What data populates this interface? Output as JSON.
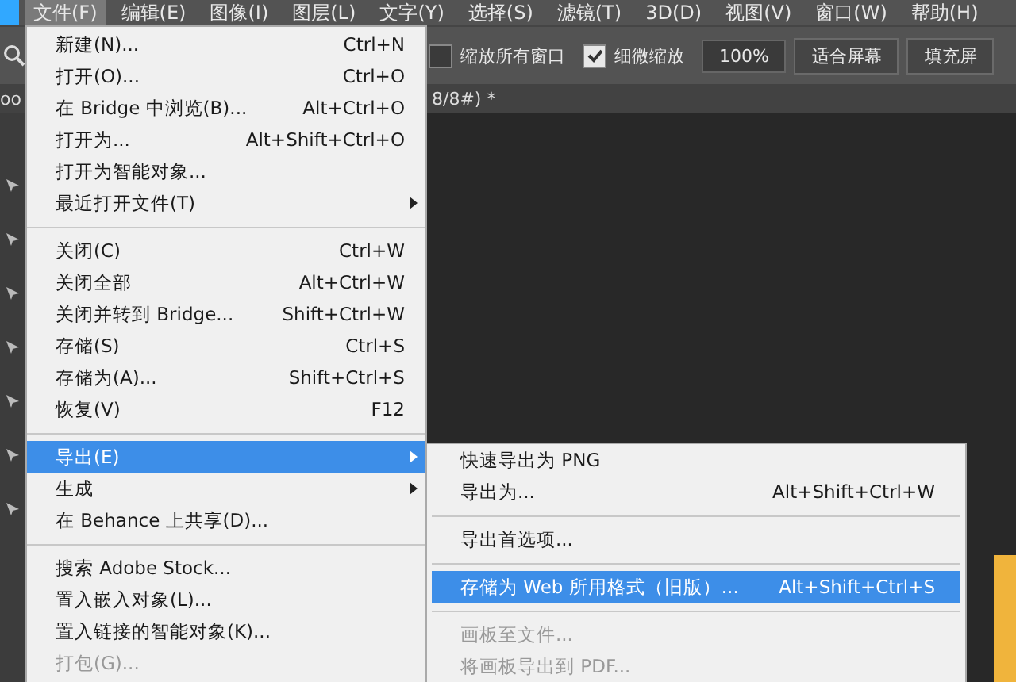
{
  "menubar": [
    {
      "label": "文件(F)",
      "selected": true
    },
    {
      "label": "编辑(E)",
      "selected": false
    },
    {
      "label": "图像(I)",
      "selected": false
    },
    {
      "label": "图层(L)",
      "selected": false
    },
    {
      "label": "文字(Y)",
      "selected": false
    },
    {
      "label": "选择(S)",
      "selected": false
    },
    {
      "label": "滤镜(T)",
      "selected": false
    },
    {
      "label": "3D(D)",
      "selected": false
    },
    {
      "label": "视图(V)",
      "selected": false
    },
    {
      "label": "窗口(W)",
      "selected": false
    },
    {
      "label": "帮助(H)",
      "selected": false
    }
  ],
  "options_bar": {
    "checkboxes": [
      {
        "label": "缩放所有窗口",
        "checked": false
      },
      {
        "label": "细微缩放",
        "checked": true
      }
    ],
    "zoom_value": "100%",
    "buttons": [
      "适合屏幕",
      "填充屏"
    ]
  },
  "document_tab": {
    "title_left": "oo",
    "title_right": "8/8#) *"
  },
  "file_menu": [
    {
      "kind": "item",
      "label": "新建(N)...",
      "shortcut": "Ctrl+N",
      "selected": false,
      "disabled": false,
      "submenu": false
    },
    {
      "kind": "item",
      "label": "打开(O)...",
      "shortcut": "Ctrl+O",
      "selected": false,
      "disabled": false,
      "submenu": false
    },
    {
      "kind": "item",
      "label": "在 Bridge 中浏览(B)...",
      "shortcut": "Alt+Ctrl+O",
      "selected": false,
      "disabled": false,
      "submenu": false
    },
    {
      "kind": "item",
      "label": "打开为...",
      "shortcut": "Alt+Shift+Ctrl+O",
      "selected": false,
      "disabled": false,
      "submenu": false
    },
    {
      "kind": "item",
      "label": "打开为智能对象...",
      "selected": false,
      "disabled": false,
      "submenu": false
    },
    {
      "kind": "item",
      "label": "最近打开文件(T)",
      "selected": false,
      "disabled": false,
      "submenu": true
    },
    {
      "kind": "separator"
    },
    {
      "kind": "item",
      "label": "关闭(C)",
      "shortcut": "Ctrl+W",
      "selected": false,
      "disabled": false,
      "submenu": false
    },
    {
      "kind": "item",
      "label": "关闭全部",
      "shortcut": "Alt+Ctrl+W",
      "selected": false,
      "disabled": false,
      "submenu": false
    },
    {
      "kind": "item",
      "label": "关闭并转到 Bridge...",
      "shortcut": "Shift+Ctrl+W",
      "selected": false,
      "disabled": false,
      "submenu": false
    },
    {
      "kind": "item",
      "label": "存储(S)",
      "shortcut": "Ctrl+S",
      "selected": false,
      "disabled": false,
      "submenu": false
    },
    {
      "kind": "item",
      "label": "存储为(A)...",
      "shortcut": "Shift+Ctrl+S",
      "selected": false,
      "disabled": false,
      "submenu": false
    },
    {
      "kind": "item",
      "label": "恢复(V)",
      "shortcut": "F12",
      "selected": false,
      "disabled": false,
      "submenu": false
    },
    {
      "kind": "separator"
    },
    {
      "kind": "item",
      "label": "导出(E)",
      "selected": true,
      "disabled": false,
      "submenu": true
    },
    {
      "kind": "item",
      "label": "生成",
      "selected": false,
      "disabled": false,
      "submenu": true
    },
    {
      "kind": "item",
      "label": "在 Behance 上共享(D)...",
      "selected": false,
      "disabled": false,
      "submenu": false
    },
    {
      "kind": "separator"
    },
    {
      "kind": "item",
      "label": "搜索 Adobe Stock...",
      "selected": false,
      "disabled": false,
      "submenu": false
    },
    {
      "kind": "item",
      "label": "置入嵌入对象(L)...",
      "selected": false,
      "disabled": false,
      "submenu": false
    },
    {
      "kind": "item",
      "label": "置入链接的智能对象(K)...",
      "selected": false,
      "disabled": false,
      "submenu": false
    },
    {
      "kind": "item",
      "label": "打包(G)...",
      "selected": false,
      "disabled": true,
      "submenu": false
    }
  ],
  "export_submenu": [
    {
      "kind": "item",
      "label": "快速导出为 PNG",
      "selected": false,
      "disabled": false
    },
    {
      "kind": "item",
      "label": "导出为...",
      "shortcut": "Alt+Shift+Ctrl+W",
      "selected": false,
      "disabled": false
    },
    {
      "kind": "separator"
    },
    {
      "kind": "item",
      "label": "导出首选项...",
      "selected": false,
      "disabled": false
    },
    {
      "kind": "separator"
    },
    {
      "kind": "item",
      "label": "存储为 Web 所用格式（旧版）...",
      "shortcut": "Alt+Shift+Ctrl+S",
      "selected": true,
      "disabled": false
    },
    {
      "kind": "separator"
    },
    {
      "kind": "item",
      "label": "画板至文件...",
      "selected": false,
      "disabled": true
    },
    {
      "kind": "item",
      "label": "将画板导出到 PDF...",
      "selected": false,
      "disabled": true
    }
  ]
}
